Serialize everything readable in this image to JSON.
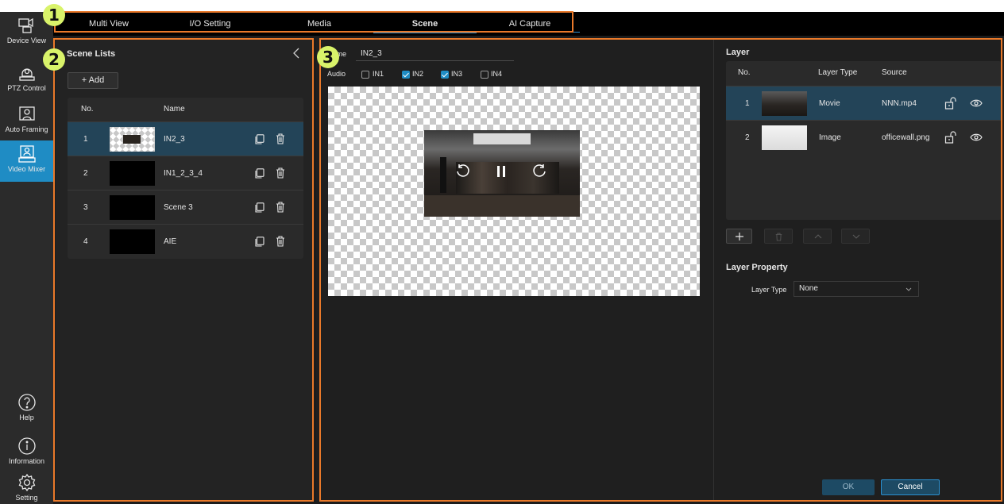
{
  "nav": {
    "items": [
      {
        "label": "Device View",
        "icon": "device-view-icon"
      },
      {
        "label": "PTZ Control",
        "icon": "ptz-control-icon"
      },
      {
        "label": "Auto Framing",
        "icon": "auto-framing-icon"
      },
      {
        "label": "Video Mixer",
        "icon": "video-mixer-icon"
      }
    ],
    "bottom": [
      {
        "label": "Help",
        "icon": "help-icon"
      },
      {
        "label": "Information",
        "icon": "information-icon"
      },
      {
        "label": "Setting",
        "icon": "gear-icon"
      }
    ]
  },
  "tabs": [
    "Multi View",
    "I/O Setting",
    "Media",
    "Scene",
    "AI Capture"
  ],
  "active_tab": "Scene",
  "callouts": [
    "1",
    "2",
    "3"
  ],
  "scene_list": {
    "title": "Scene Lists",
    "add_label": "+ Add",
    "columns": [
      "No.",
      "Name"
    ],
    "rows": [
      {
        "no": "1",
        "name": "IN2_3"
      },
      {
        "no": "2",
        "name": "IN1_2_3_4"
      },
      {
        "no": "3",
        "name": "Scene 3"
      },
      {
        "no": "4",
        "name": "AIE"
      }
    ]
  },
  "scene_editor": {
    "name_label": "Name",
    "name_value": "IN2_3",
    "audio_label": "Audio",
    "audio_inputs": [
      {
        "label": "IN1",
        "checked": false
      },
      {
        "label": "IN2",
        "checked": true
      },
      {
        "label": "IN3",
        "checked": true
      },
      {
        "label": "IN4",
        "checked": false
      }
    ]
  },
  "layer": {
    "title": "Layer",
    "columns": [
      "No.",
      "Layer Type",
      "Source"
    ],
    "rows": [
      {
        "no": "1",
        "type": "Movie",
        "source": "NNN.mp4"
      },
      {
        "no": "2",
        "type": "Image",
        "source": "officewall.png"
      }
    ],
    "property_title": "Layer Property",
    "layer_type_label": "Layer Type",
    "layer_type_value": "None",
    "ok_label": "OK",
    "cancel_label": "Cancel"
  },
  "colors": {
    "accent": "#1f8cc4",
    "callout_border": "#e9792a",
    "callout_badge": "#d9f36a"
  }
}
